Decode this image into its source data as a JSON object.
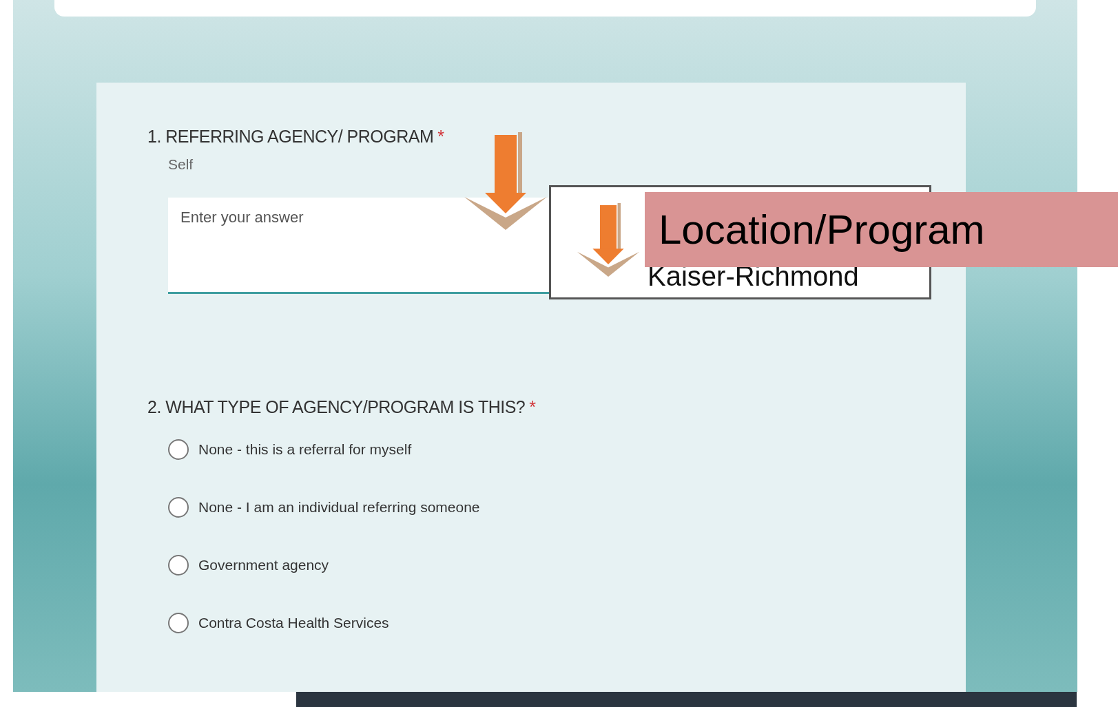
{
  "questions": [
    {
      "number": "1.",
      "title": "REFERRING AGENCY/ PROGRAM",
      "required_mark": "*",
      "subtitle": "Self",
      "kind": "text",
      "placeholder": "Enter your answer"
    },
    {
      "number": "2.",
      "title": "WHAT TYPE OF AGENCY/PROGRAM IS THIS?",
      "required_mark": "*",
      "kind": "choice",
      "options": [
        {
          "label": "None - this is a referral for myself",
          "selected": false
        },
        {
          "label": "None - I am an individual referring someone",
          "selected": false
        },
        {
          "label": "Government agency",
          "selected": false
        },
        {
          "label": "Contra Costa Health Services",
          "selected": false
        }
      ]
    }
  ],
  "callout": {
    "value": "Kaiser-Richmond"
  },
  "banner": {
    "label": "Location/Program"
  }
}
